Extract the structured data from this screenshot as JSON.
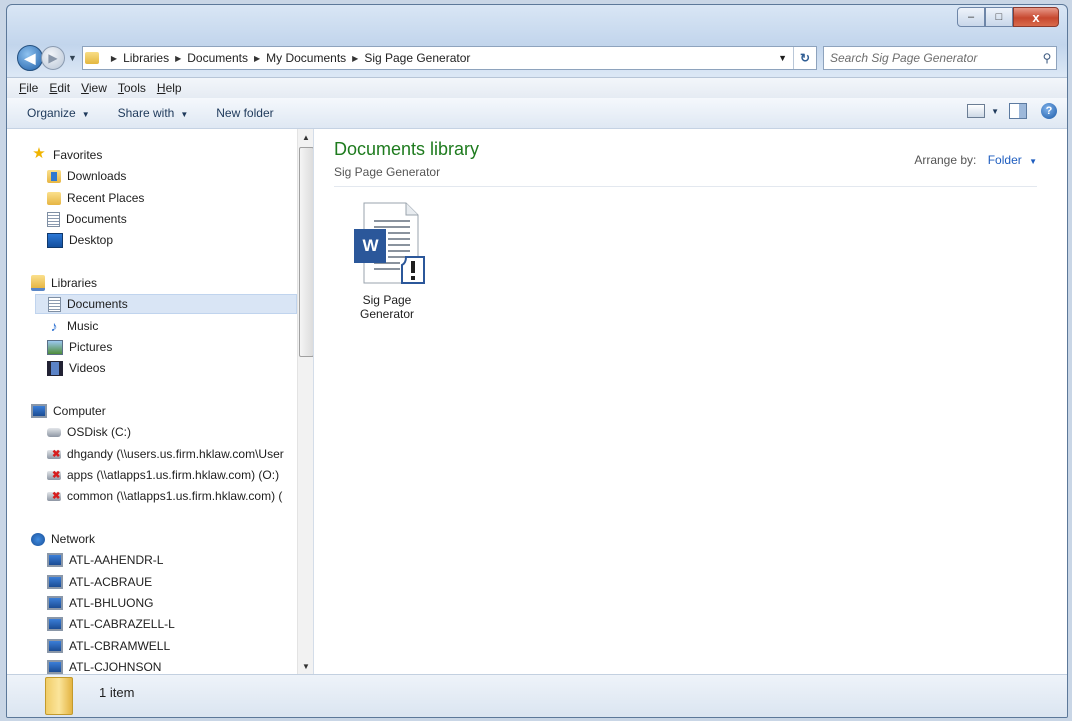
{
  "window": {
    "caption_buttons": {
      "minimize": "‒",
      "maximize": "□",
      "close": "x"
    }
  },
  "address_bar": {
    "crumbs": [
      "Libraries",
      "Documents",
      "My Documents",
      "Sig Page Generator"
    ],
    "search_placeholder": "Search Sig Page Generator"
  },
  "menubar": {
    "items": [
      {
        "accel": "F",
        "rest": "ile"
      },
      {
        "accel": "E",
        "rest": "dit"
      },
      {
        "accel": "V",
        "rest": "iew"
      },
      {
        "accel": "T",
        "rest": "ools"
      },
      {
        "accel": "H",
        "rest": "elp"
      }
    ]
  },
  "toolbar": {
    "organize": "Organize",
    "share_with": "Share with",
    "new_folder": "New folder"
  },
  "nav": {
    "favorites": "Favorites",
    "downloads": "Downloads",
    "recent_places": "Recent Places",
    "fav_documents": "Documents",
    "desktop": "Desktop",
    "libraries": "Libraries",
    "lib_documents": "Documents",
    "music": "Music",
    "pictures": "Pictures",
    "videos": "Videos",
    "computer": "Computer",
    "osdisk": "OSDisk (C:)",
    "drive_dhgandy": "dhgandy (\\\\users.us.firm.hklaw.com\\User",
    "drive_apps": "apps (\\\\atlapps1.us.firm.hklaw.com) (O:)",
    "drive_common": "common (\\\\atlapps1.us.firm.hklaw.com) (",
    "network": "Network",
    "network_pcs": [
      "ATL-AAHENDR-L",
      "ATL-ACBRAUE",
      "ATL-BHLUONG",
      "ATL-CABRAZELL-L",
      "ATL-CBRAMWELL",
      "ATL-CJOHNSON"
    ]
  },
  "content": {
    "library_title": "Documents library",
    "library_subtitle": "Sig Page Generator",
    "arrange_label": "Arrange by:",
    "arrange_value": "Folder",
    "file_name_line1": "Sig Page",
    "file_name_line2": "Generator",
    "file_icon_letter": "W"
  },
  "status": {
    "item_count": "1 item"
  },
  "colors": {
    "library_title": "#1e7b1e",
    "link_blue": "#1e5dbf",
    "word_blue": "#2b579a"
  }
}
